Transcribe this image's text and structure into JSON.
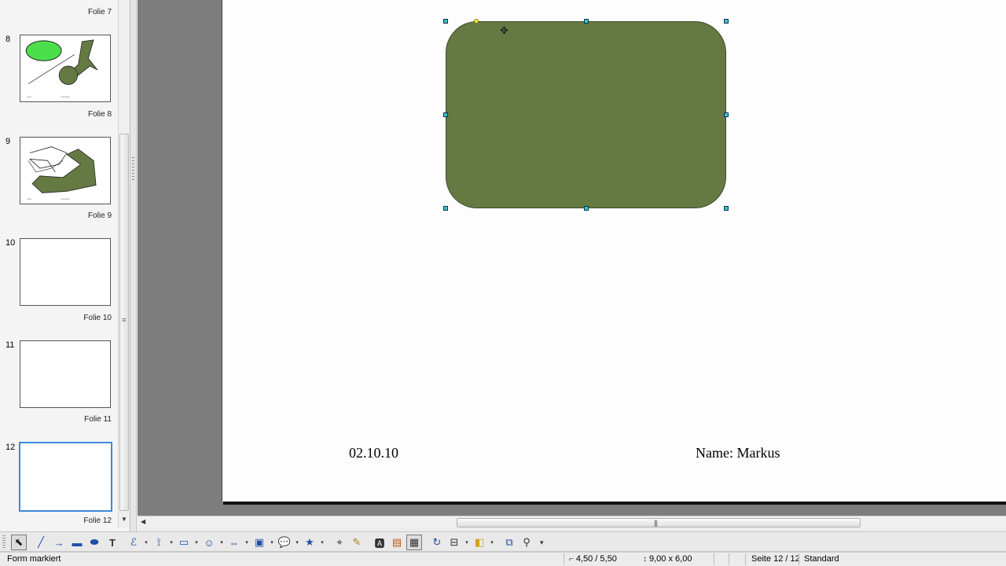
{
  "slide_pane": {
    "slides": [
      {
        "number": "",
        "label": "Folie 7"
      },
      {
        "number": "8",
        "label": "Folie 8"
      },
      {
        "number": "9",
        "label": "Folie 9"
      },
      {
        "number": "10",
        "label": "Folie 10"
      },
      {
        "number": "11",
        "label": "Folie 11"
      },
      {
        "number": "12",
        "label": "Folie 12"
      }
    ]
  },
  "slide": {
    "date_field": "02.10.10",
    "name_field": "Name: Markus",
    "shape_fill": "#657a43",
    "handle_color": "#33c7c7",
    "control_point_color": "#f2e84a"
  },
  "toolbar": {
    "icons": [
      "select-icon",
      "line-icon",
      "arrow-line-icon",
      "rectangle-icon",
      "ellipse-icon",
      "text-icon",
      "curve-icon",
      "connector-icon",
      "basic-shapes-icon",
      "symbol-shapes-icon",
      "block-arrows-icon",
      "flowchart-icon",
      "callouts-icon",
      "stars-icon",
      "points-icon",
      "glue-points-icon",
      "fontwork-icon",
      "from-file-icon",
      "gallery-icon",
      "rotate-icon",
      "align-icon",
      "arrange-icon",
      "extrusion-icon",
      "glue-icon"
    ]
  },
  "statusbar": {
    "status_text": "Form markiert",
    "position": "4,50 / 5,50",
    "size": "9,00 x 6,00",
    "page": "Seite 12 / 12",
    "layout": "Standard"
  }
}
